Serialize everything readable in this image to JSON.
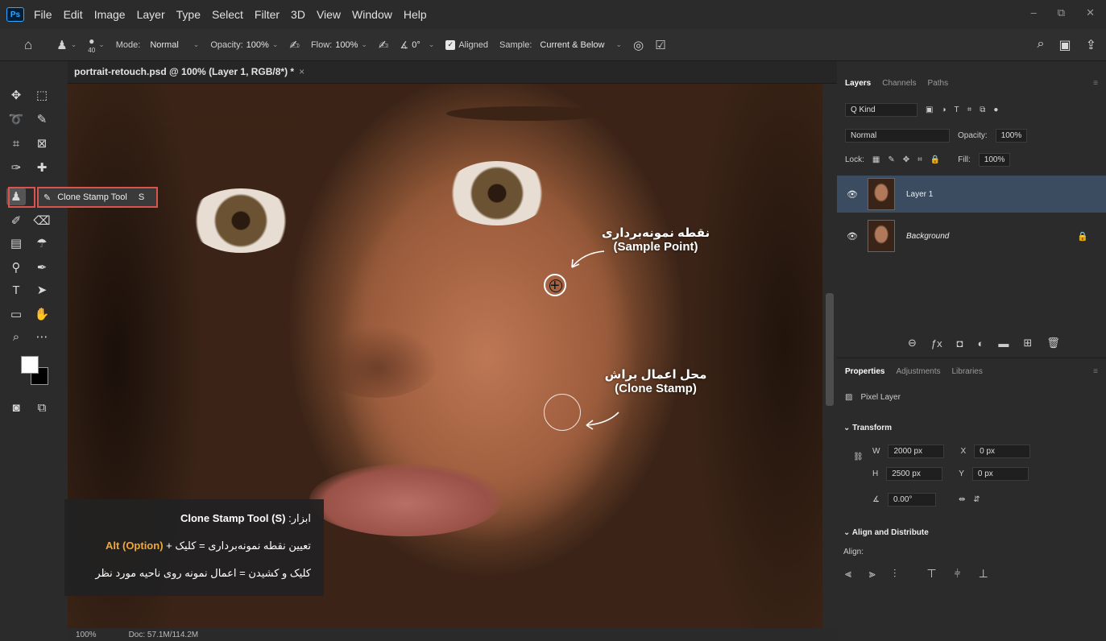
{
  "app": {
    "logo": "Ps",
    "menu": [
      "File",
      "Edit",
      "Image",
      "Layer",
      "Type",
      "Select",
      "Filter",
      "3D",
      "View",
      "Window",
      "Help"
    ]
  },
  "window_controls": [
    "–",
    "⧉",
    "✕"
  ],
  "options": {
    "brush_size": "40",
    "mode_label": "Mode:",
    "mode_value": "Normal",
    "opacity_label": "Opacity:",
    "opacity_value": "100%",
    "flow_label": "Flow:",
    "flow_value": "100%",
    "angle_value": "0°",
    "aligned_label": "Aligned",
    "sample_label": "Sample:",
    "sample_value": "Current & Below"
  },
  "document": {
    "tab_title": "portrait-retouch.psd @ 100% (Layer 1, RGB/8*) *",
    "close": "×"
  },
  "tooltip": {
    "label": "Clone Stamp Tool",
    "shortcut": "S"
  },
  "annotations": {
    "sample_fa": "نقطه نمونه‌برداری",
    "sample_en": "(Sample Point)",
    "brush_fa": "محل اعمال براش",
    "brush_en": "(Clone Stamp)"
  },
  "info_box": {
    "line1_prefix": "ابزار:",
    "line1_tool": "Clone Stamp Tool (S)",
    "line2_text": "تعیین نقطه نمونه‌برداری = کلیک +",
    "line2_key": "Alt (Option)",
    "line3": "کلیک و کشیدن = اعمال نمونه روی ناحیه مورد نظر"
  },
  "status": {
    "zoom": "100%",
    "doc": "Doc: 57.1M/114.2M"
  },
  "layers_panel": {
    "tabs": [
      "Layers",
      "Channels",
      "Paths"
    ],
    "kind": "Q Kind",
    "blend": "Normal",
    "opacity_label": "Opacity:",
    "opacity_value": "100%",
    "lock_label": "Lock:",
    "fill_label": "Fill:",
    "fill_value": "100%",
    "layers": [
      {
        "name": "Layer 1",
        "selected": true
      },
      {
        "name": "Background",
        "selected": false
      }
    ]
  },
  "properties_panel": {
    "tabs": [
      "Properties",
      "Adjustments",
      "Libraries"
    ],
    "type": "Pixel Layer",
    "transform_head": "Transform",
    "w_label": "W",
    "w_value": "2000 px",
    "h_label": "H",
    "h_value": "2500 px",
    "x_label": "X",
    "x_value": "0 px",
    "y_label": "Y",
    "y_value": "0 px",
    "angle_value": "0.00°",
    "align_head": "Align and Distribute",
    "align_label": "Align:"
  }
}
